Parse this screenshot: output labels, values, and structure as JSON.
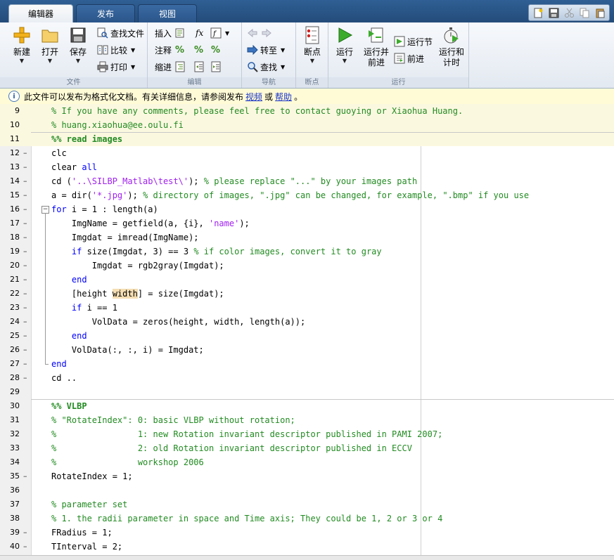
{
  "tabs": [
    {
      "label": "编辑器",
      "active": true
    },
    {
      "label": "发布",
      "active": false
    },
    {
      "label": "视图",
      "active": false
    }
  ],
  "quick_icons": [
    "new-doc-icon",
    "save-icon",
    "cut-icon",
    "copy-icon",
    "paste-icon"
  ],
  "ribbon": {
    "file": {
      "group_label": "文件",
      "new": "新建",
      "open": "打开",
      "save": "保存",
      "find_files": "查找文件",
      "compare": "比较",
      "print": "打印"
    },
    "edit": {
      "group_label": "编辑",
      "insert": "插入",
      "comment": "注释",
      "indent": "缩进",
      "fx": "fx"
    },
    "nav": {
      "group_label": "导航",
      "goto": "转至",
      "find": "查找"
    },
    "breakpoints": {
      "group_label": "断点",
      "label": "断点"
    },
    "run": {
      "group_label": "运行",
      "run": "运行",
      "run_advance": "运行并\n前进",
      "run_section": "运行节",
      "advance": "前进",
      "run_time": "运行和\n计时"
    }
  },
  "infobar": {
    "text": "此文件可以发布为格式化文档。有关详细信息，请参阅发布",
    "link1": "视频",
    "or": "或",
    "link2": "帮助",
    "end": "。"
  },
  "colors": {
    "comment": "#228b22",
    "keyword": "#0000ff",
    "string": "#a020f0",
    "cell_header_bg": "#fbf8e0"
  },
  "code_lines": [
    {
      "n": "9",
      "dash": false,
      "parts": [
        [
          "cm",
          "% If you have any comments, please feel free to contact guoying or Xiaohua Huang."
        ]
      ]
    },
    {
      "n": "10",
      "dash": false,
      "parts": [
        [
          "cm",
          "% huang.xiaohua@ee.oulu.fi"
        ]
      ]
    },
    {
      "n": "11",
      "dash": false,
      "parts": [
        [
          "cell",
          "%% read images"
        ]
      ]
    },
    {
      "n": "12",
      "dash": true,
      "parts": [
        [
          "",
          "clc"
        ]
      ]
    },
    {
      "n": "13",
      "dash": true,
      "parts": [
        [
          "",
          "clear "
        ],
        [
          "kw",
          "all"
        ]
      ]
    },
    {
      "n": "14",
      "dash": true,
      "parts": [
        [
          "",
          "cd ("
        ],
        [
          "st",
          "'..\\SILBP_Matlab\\test\\'"
        ],
        [
          "",
          "); "
        ],
        [
          "cm",
          "% please replace \"...\" by your images path"
        ]
      ]
    },
    {
      "n": "15",
      "dash": true,
      "parts": [
        [
          "",
          "a = dir("
        ],
        [
          "st",
          "'*.jpg'"
        ],
        [
          "",
          "); "
        ],
        [
          "cm",
          "% directory of images, \".jpg\" can be changed, for example, \".bmp\" if you use"
        ]
      ]
    },
    {
      "n": "16",
      "dash": true,
      "fold": "open",
      "parts": [
        [
          "kw",
          "for"
        ],
        [
          "",
          " i = 1 : length(a)"
        ]
      ]
    },
    {
      "n": "17",
      "dash": true,
      "parts": [
        [
          "",
          "    ImgName = getfield(a, {i}, "
        ],
        [
          "st",
          "'name'"
        ],
        [
          "",
          ");"
        ]
      ]
    },
    {
      "n": "18",
      "dash": true,
      "parts": [
        [
          "",
          "    Imgdat = imread(ImgName);"
        ]
      ]
    },
    {
      "n": "19",
      "dash": true,
      "parts": [
        [
          "",
          "    "
        ],
        [
          "kw",
          "if"
        ],
        [
          "",
          " size(Imgdat, 3) == 3 "
        ],
        [
          "cm",
          "% if color images, convert it to gray"
        ]
      ]
    },
    {
      "n": "20",
      "dash": true,
      "parts": [
        [
          "",
          "        Imgdat = rgb2gray(Imgdat);"
        ]
      ]
    },
    {
      "n": "21",
      "dash": true,
      "parts": [
        [
          "",
          "    "
        ],
        [
          "kw",
          "end"
        ]
      ]
    },
    {
      "n": "22",
      "dash": true,
      "parts": [
        [
          "",
          "    [height "
        ],
        [
          "mark",
          "width"
        ],
        [
          "",
          "] = size(Imgdat);"
        ]
      ]
    },
    {
      "n": "23",
      "dash": true,
      "parts": [
        [
          "",
          "    "
        ],
        [
          "kw",
          "if"
        ],
        [
          "",
          " i == 1"
        ]
      ]
    },
    {
      "n": "24",
      "dash": true,
      "parts": [
        [
          "",
          "        VolData = zeros(height, width, length(a));"
        ]
      ]
    },
    {
      "n": "25",
      "dash": true,
      "parts": [
        [
          "",
          "    "
        ],
        [
          "kw",
          "end"
        ]
      ]
    },
    {
      "n": "26",
      "dash": true,
      "parts": [
        [
          "",
          "    VolData(:, :, i) = Imgdat;"
        ]
      ]
    },
    {
      "n": "27",
      "dash": true,
      "fold": "end",
      "parts": [
        [
          "kw",
          "end"
        ]
      ]
    },
    {
      "n": "28",
      "dash": true,
      "parts": [
        [
          "",
          "cd .."
        ]
      ]
    },
    {
      "n": "29",
      "dash": false,
      "parts": []
    },
    {
      "n": "30",
      "dash": false,
      "parts": [
        [
          "cell",
          "%% VLBP"
        ]
      ]
    },
    {
      "n": "31",
      "dash": false,
      "parts": [
        [
          "cm",
          "% \"RotateIndex\": 0: basic VLBP without rotation;"
        ]
      ]
    },
    {
      "n": "32",
      "dash": false,
      "parts": [
        [
          "cm",
          "%                1: new Rotation invariant descriptor published in PAMI 2007;"
        ]
      ]
    },
    {
      "n": "33",
      "dash": false,
      "parts": [
        [
          "cm",
          "%                2: old Rotation invariant descriptor published in ECCV"
        ]
      ]
    },
    {
      "n": "34",
      "dash": false,
      "parts": [
        [
          "cm",
          "%                workshop 2006"
        ]
      ]
    },
    {
      "n": "35",
      "dash": true,
      "parts": [
        [
          "",
          "RotateIndex = 1;"
        ]
      ]
    },
    {
      "n": "36",
      "dash": false,
      "parts": []
    },
    {
      "n": "37",
      "dash": false,
      "parts": [
        [
          "cm",
          "% parameter set"
        ]
      ]
    },
    {
      "n": "38",
      "dash": false,
      "parts": [
        [
          "cm",
          "% 1. the radii parameter in space and Time axis; They could be 1, 2 or 3 or 4"
        ]
      ]
    },
    {
      "n": "39",
      "dash": true,
      "parts": [
        [
          "",
          "FRadius = 1;"
        ]
      ]
    },
    {
      "n": "40",
      "dash": true,
      "parts": [
        [
          "",
          "TInterval = 2;"
        ]
      ]
    }
  ]
}
